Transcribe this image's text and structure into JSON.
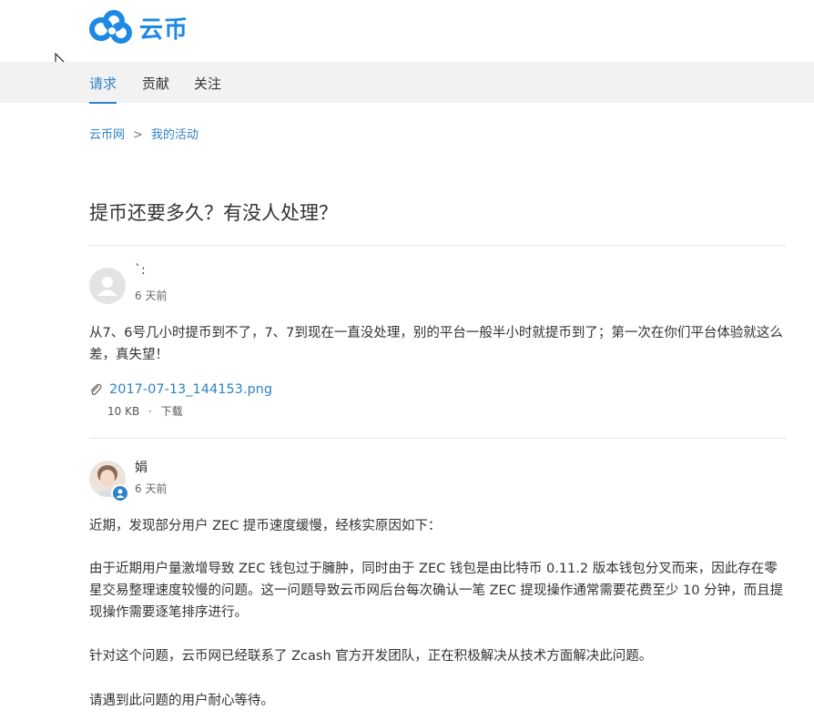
{
  "brand": {
    "logo_text": "云币",
    "accent": "#1e88e5"
  },
  "nav": {
    "items": [
      {
        "label": "请求",
        "active": true
      },
      {
        "label": "贡献",
        "active": false
      },
      {
        "label": "关注",
        "active": false
      }
    ]
  },
  "breadcrumb": {
    "root": "云币网",
    "separator": ">",
    "current": "我的活动"
  },
  "request": {
    "title": "提币还要多久？有没人处理？"
  },
  "comments": [
    {
      "author": "`:",
      "time": "6 天前",
      "body": "从7、6号几小时提币到不了，7、7到现在一直没处理，别的平台一般半小时就提币到了；第一次在你们平台体验就这么差，真失望！",
      "attachment": {
        "name": "2017-07-13_144153.png",
        "size": "10 KB",
        "sep": "·",
        "download_label": "下载"
      }
    },
    {
      "author": "娟",
      "time": "6 天前",
      "paragraphs": [
        "近期，发现部分用户 ZEC 提币速度缓慢，经核实原因如下：",
        "由于近期用户量激增导致 ZEC 钱包过于臃肿，同时由于 ZEC 钱包是由比特币 0.11.2 版本钱包分叉而来，因此存在零星交易整理速度较慢的问题。这一问题导致云币网后台每次确认一笔 ZEC 提现操作通常需要花费至少 10 分钟，而且提现操作需要逐笔排序进行。",
        "针对这个问题，云币网已经联系了 Zcash 官方开发团队，正在积极解决从技术方面解决此问题。",
        "请遇到此问题的用户耐心等待。"
      ]
    }
  ]
}
